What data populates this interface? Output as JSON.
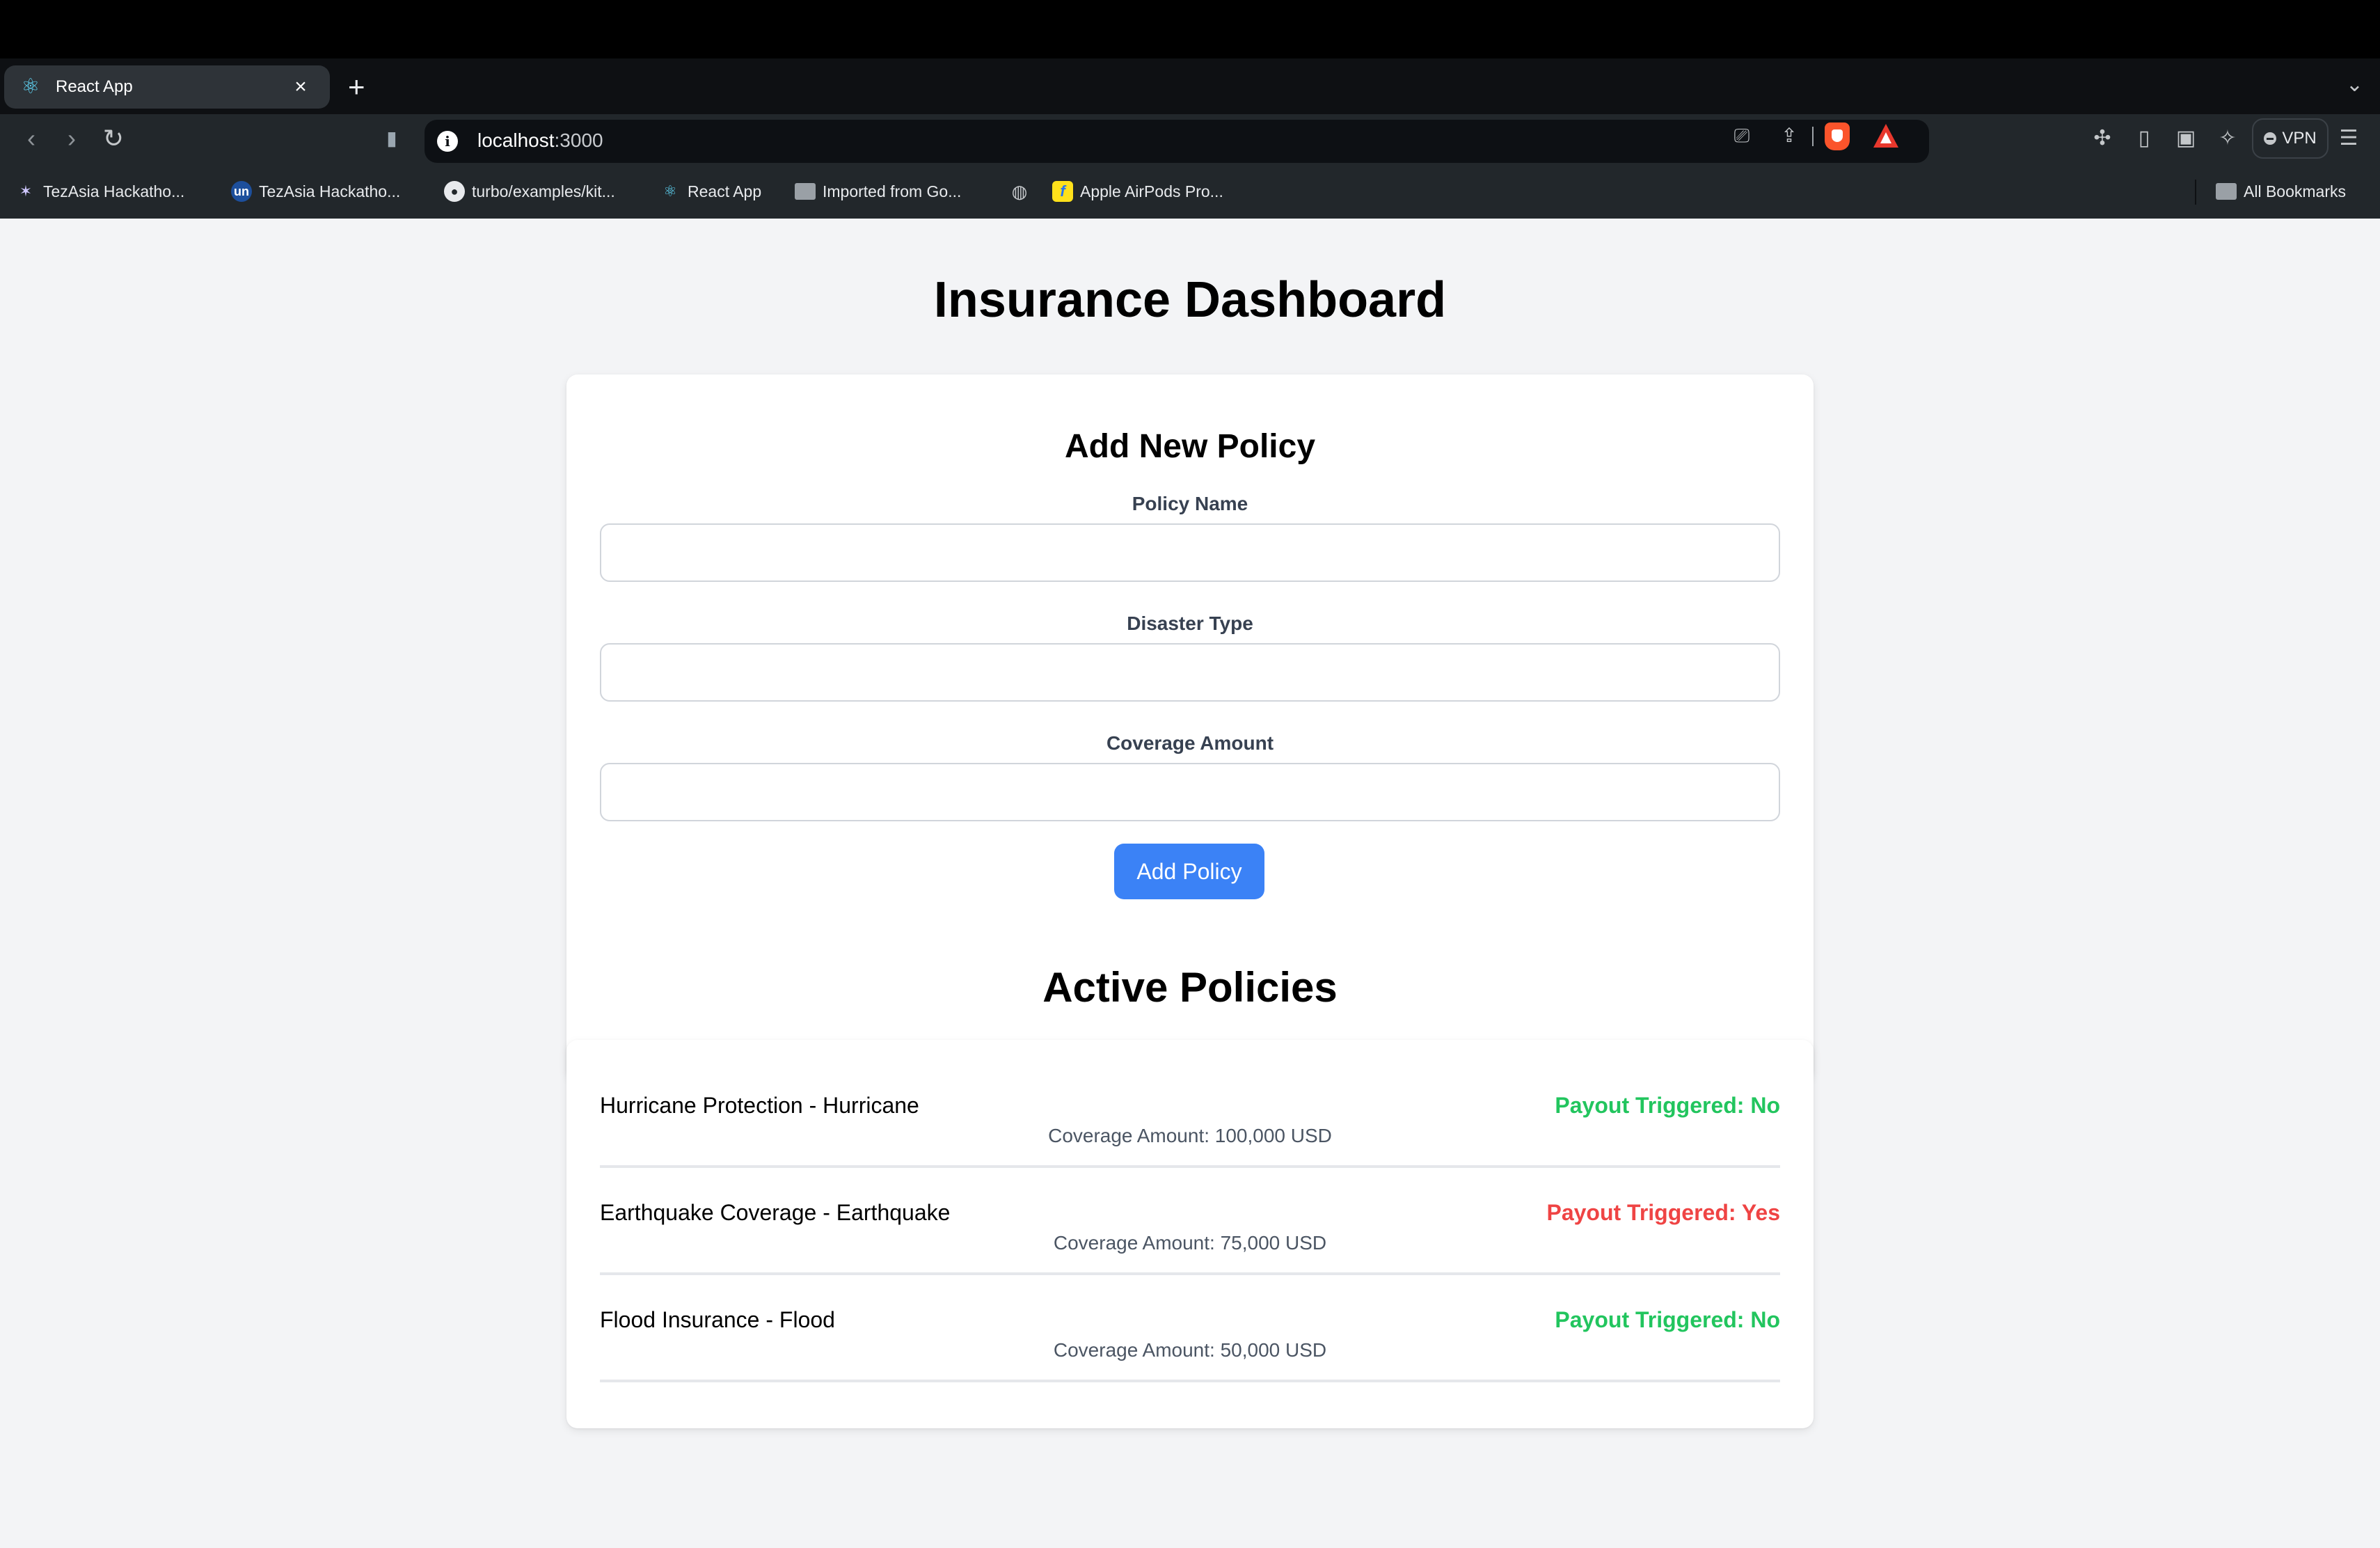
{
  "browser": {
    "tab": {
      "title": "React App",
      "favicon": "react-icon",
      "close": "×"
    },
    "new_tab": "+",
    "tab_menu": "⌄",
    "nav": {
      "back": "‹",
      "forward": "›",
      "reload": "↻",
      "bookmark": "🔖"
    },
    "address": {
      "host": "localhost",
      "port": ":3000"
    },
    "omnibox_icons": [
      "cast-icon",
      "share-icon",
      "brave-shields-icon",
      "brave-rewards-icon"
    ],
    "toolbar_icons": [
      "extensions-icon",
      "sidebar-icon",
      "wallet-icon",
      "leo-ai-icon"
    ],
    "vpn_label": "VPN",
    "menu": "☰",
    "bookmarks": [
      {
        "label": "TezAsia Hackatho...",
        "icon": "tezasia-icon"
      },
      {
        "label": "TezAsia Hackatho...",
        "icon": "unstop-icon"
      },
      {
        "label": "turbo/examples/kit...",
        "icon": "github-icon"
      },
      {
        "label": "React App",
        "icon": "react-icon"
      },
      {
        "label": "Imported from Go...",
        "icon": "folder-icon"
      },
      {
        "label": "",
        "icon": "globe-icon"
      },
      {
        "label": "Apple AirPods Pro...",
        "icon": "flipkart-icon"
      }
    ],
    "all_bookmarks": "All Bookmarks"
  },
  "page": {
    "title": "Insurance Dashboard",
    "form": {
      "heading": "Add New Policy",
      "fields": [
        {
          "label": "Policy Name",
          "value": "",
          "placeholder": ""
        },
        {
          "label": "Disaster Type",
          "value": "",
          "placeholder": ""
        },
        {
          "label": "Coverage Amount",
          "value": "",
          "placeholder": ""
        }
      ],
      "submit_label": "Add Policy"
    },
    "policies_heading": "Active Policies",
    "policies": [
      {
        "name": "Hurricane Protection - Hurricane",
        "coverage": "Coverage Amount: 100,000 USD",
        "status": "Payout Triggered: No",
        "triggered": false
      },
      {
        "name": "Earthquake Coverage - Earthquake",
        "coverage": "Coverage Amount: 75,000 USD",
        "status": "Payout Triggered: Yes",
        "triggered": true
      },
      {
        "name": "Flood Insurance - Flood",
        "coverage": "Coverage Amount: 50,000 USD",
        "status": "Payout Triggered: No",
        "triggered": false
      }
    ],
    "colors": {
      "accent": "#3b82f6",
      "status_no": "#22c55e",
      "status_yes": "#ef4444",
      "background": "#f3f4f6"
    }
  }
}
